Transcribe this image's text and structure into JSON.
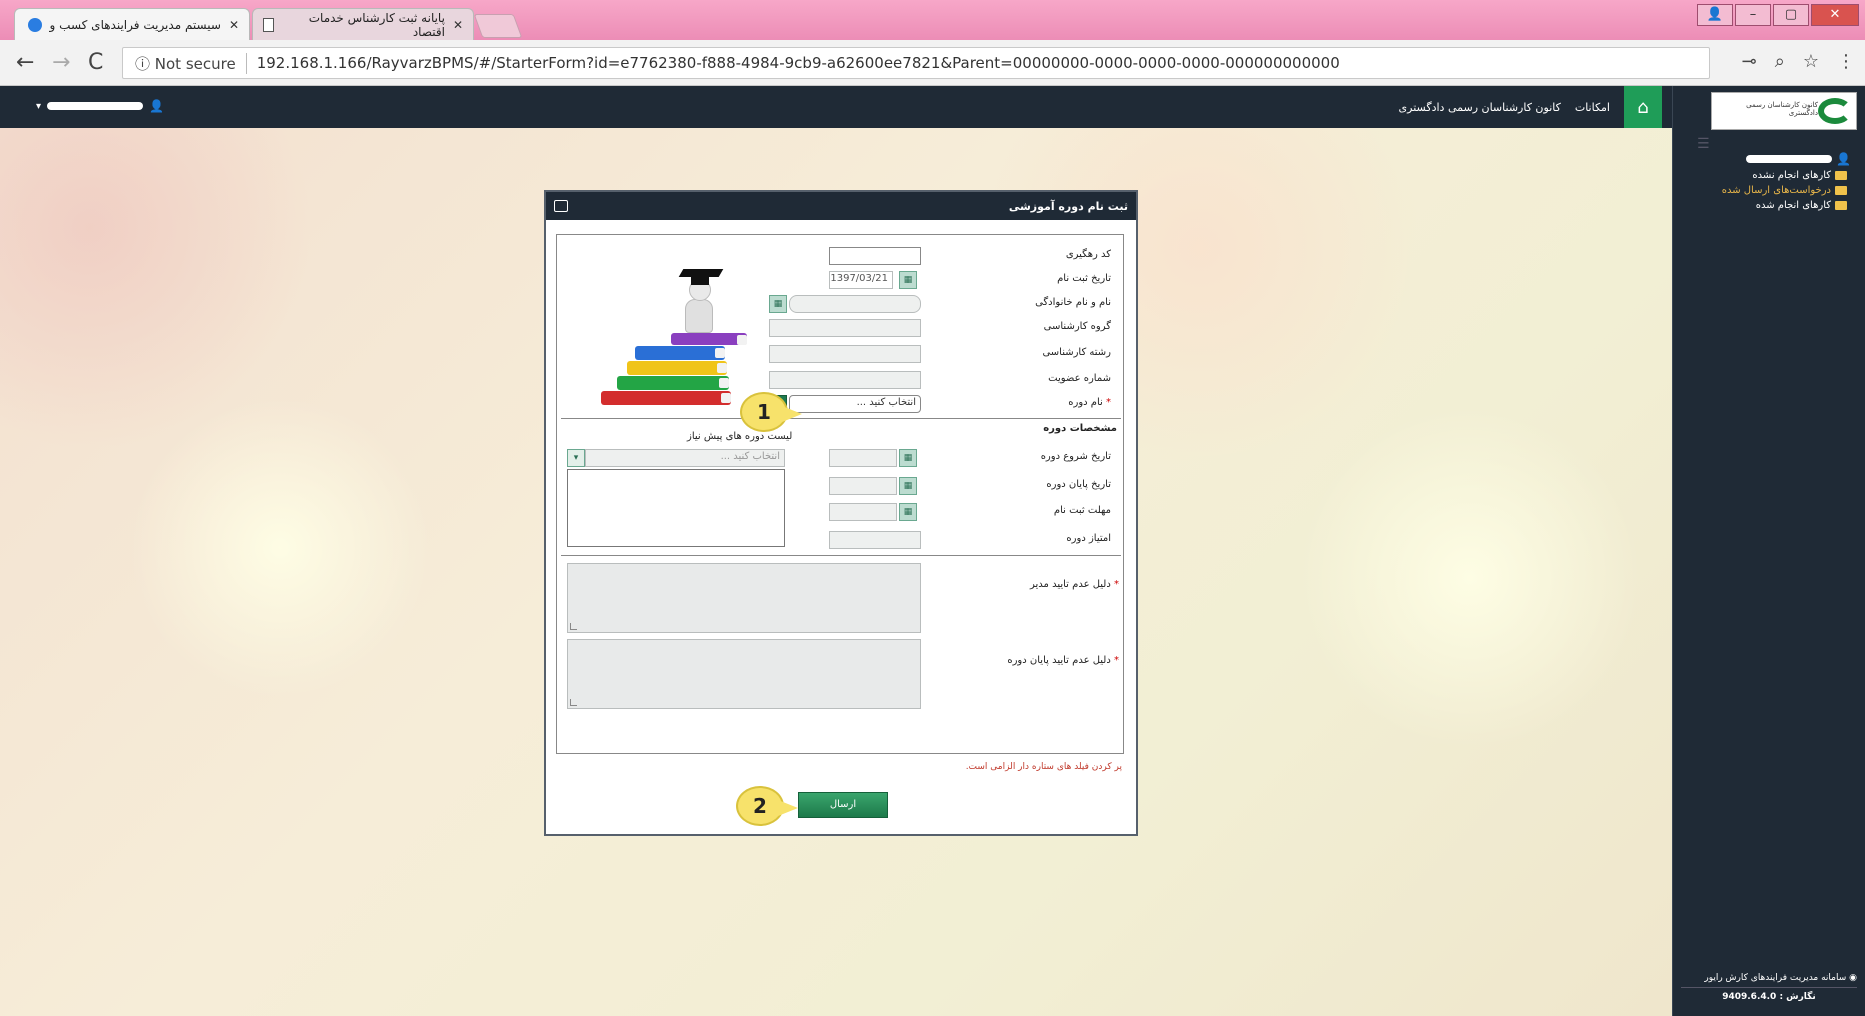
{
  "browser": {
    "tabs": [
      {
        "title": "سیستم مدیریت فرایندهای کسب و",
        "active": true
      },
      {
        "title": "پایانه ثبت کارشناس خدمات اقتصاد",
        "active": false
      }
    ],
    "security_label": "Not secure",
    "url": "192.168.1.166/RayvarzBPMS/#/StarterForm?id=e7762380-f888-4984-9cb9-a62600ee7821&Parent=00000000-0000-0000-0000-000000000000"
  },
  "topnav": {
    "links": [
      "امکانات",
      "کانون کارشناسان رسمی دادگستری"
    ]
  },
  "sidebar": {
    "logo_text": "کانون کارشناسان رسمی دادگستری",
    "items": [
      {
        "label": "کارهای انجام نشده",
        "highlight": false
      },
      {
        "label": "درخواست‌های ارسال شده",
        "highlight": true
      },
      {
        "label": "کارهای انجام شده",
        "highlight": false
      }
    ],
    "footer_title": "سامانه مدیریت فرایندهای کارش رایور",
    "version_label": "نگارش :",
    "version": "9409.6.4.0"
  },
  "form": {
    "title": "ثبت نام دوره آموزشی",
    "fields": {
      "tracking_code_label": "کد رهگیری",
      "registration_date_label": "تاریخ ثبت نام",
      "registration_date_value": "1397/03/21",
      "full_name_label": "نام و نام خانوادگی",
      "expert_group_label": "گروه کارشناسی",
      "expert_field_label": "رشته کارشناسی",
      "membership_label": "شماره عضویت",
      "course_name_label": "نام دوره",
      "course_name_placeholder": "انتخاب کنید ..."
    },
    "course_section": {
      "title": "مشخصات دوره",
      "prereq_title": "لیست دوره های پیش نیاز",
      "prereq_placeholder": "انتخاب کنید ...",
      "start_date_label": "تاریخ شروع دوره",
      "end_date_label": "تاریخ پایان دوره",
      "deadline_label": "مهلت ثبت نام",
      "credit_label": "امتیاز دوره"
    },
    "reasons": {
      "manager_reject_label": "دلیل عدم تایید مدیر",
      "end_reject_label": "دلیل عدم تایید پایان دوره"
    },
    "required_note": "پر کردن فیلد های ستاره دار الزامی است.",
    "submit_label": "ارسال"
  },
  "callouts": [
    "1",
    "2"
  ],
  "colors": {
    "nav": "#1f2a36",
    "accent": "#1f9d58",
    "callout": "#f7e26b"
  }
}
